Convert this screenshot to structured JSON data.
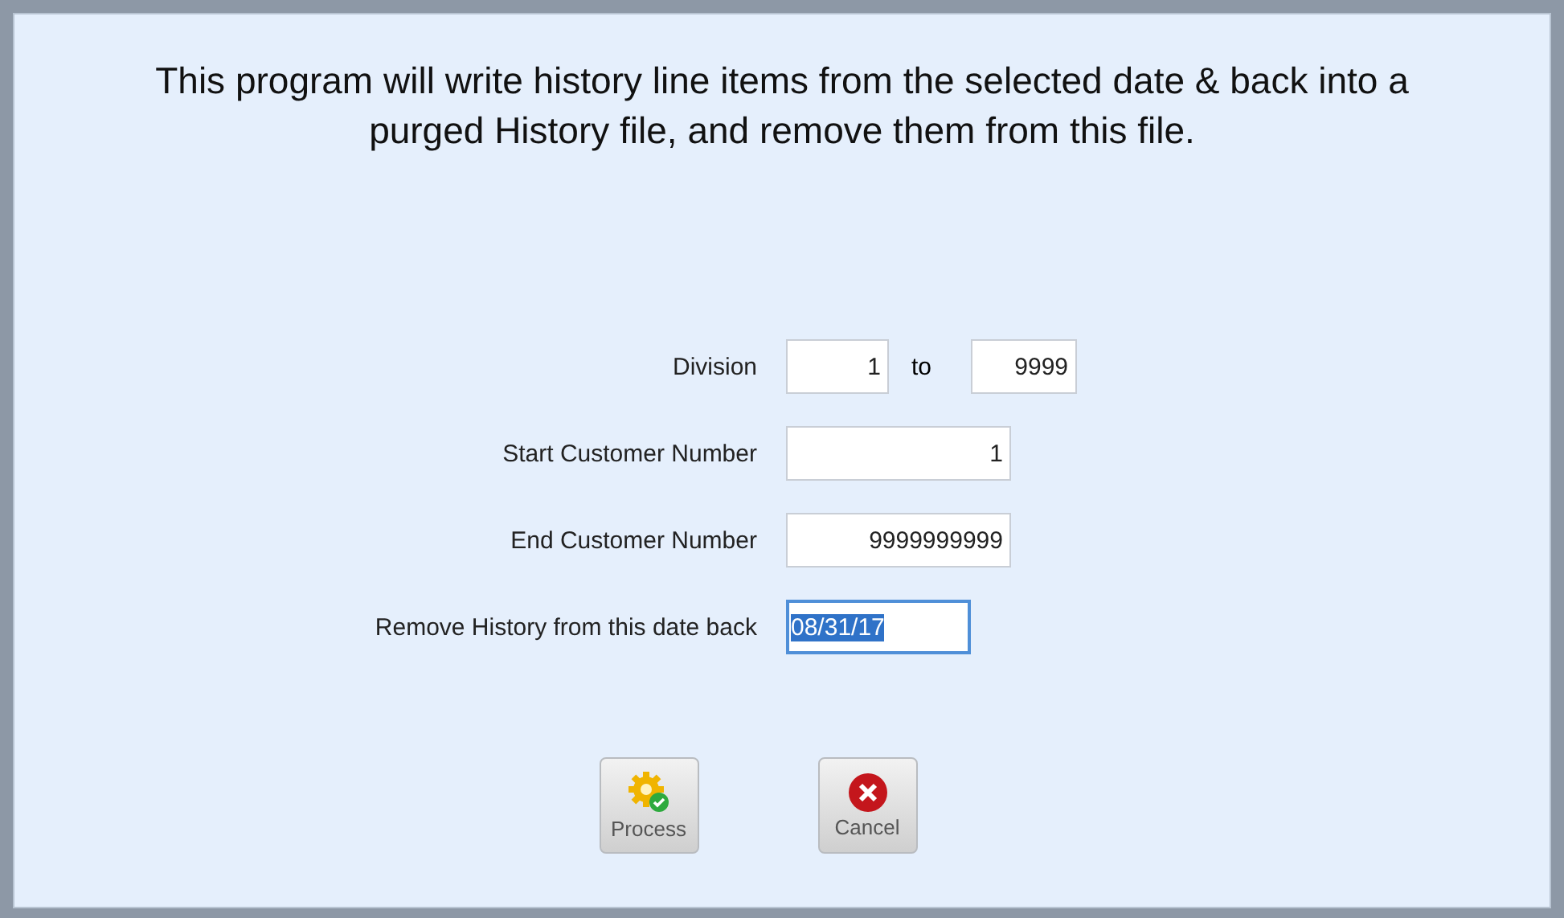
{
  "message": "This program will write history line items from the selected date & back into a purged History file, and remove them from this file.",
  "fields": [
    {
      "label": "Division",
      "value": "1",
      "focused": false,
      "range_word": "to",
      "range_value": "9999"
    },
    {
      "label": "Start Customer Number",
      "value": "1",
      "focused": false
    },
    {
      "label": "End Customer Number",
      "value": "9999999999",
      "focused": false
    },
    {
      "label": "Remove History from this date back",
      "value": "08/31/17",
      "focused": true
    }
  ],
  "buttons": [
    {
      "label": "Process",
      "kind": "process"
    },
    {
      "label": "Cancel",
      "kind": "cancel"
    }
  ]
}
